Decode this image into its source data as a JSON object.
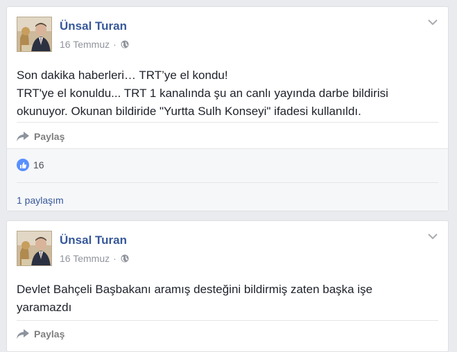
{
  "posts": [
    {
      "author": "Ünsal Turan",
      "date": "16 Temmuz",
      "separator": "·",
      "privacy_icon": "globe-icon",
      "lines": [
        "Son dakika haberleri… TRT’ye el kondu!",
        "TRT'ye el konuldu... TRT 1 kanalında şu an canlı yayında darbe bildirisi",
        "okunuyor. Okunan bildiride \"Yurtta Sulh Konseyi\" ifadesi kullanıldı."
      ],
      "share_label": "Paylaş",
      "like_count": "16",
      "share_count": "1 paylaşım"
    },
    {
      "author": "Ünsal Turan",
      "date": "16 Temmuz",
      "separator": "·",
      "privacy_icon": "globe-icon",
      "text": "Devlet Bahçeli Başbakanı aramış desteğini bildirmiş zaten başka işe yaramazdı",
      "share_label": "Paylaş"
    }
  ],
  "colors": {
    "page_bg": "#e9ebee",
    "author": "#365899",
    "meta": "#90949c",
    "like_blue": "#5890ff"
  }
}
